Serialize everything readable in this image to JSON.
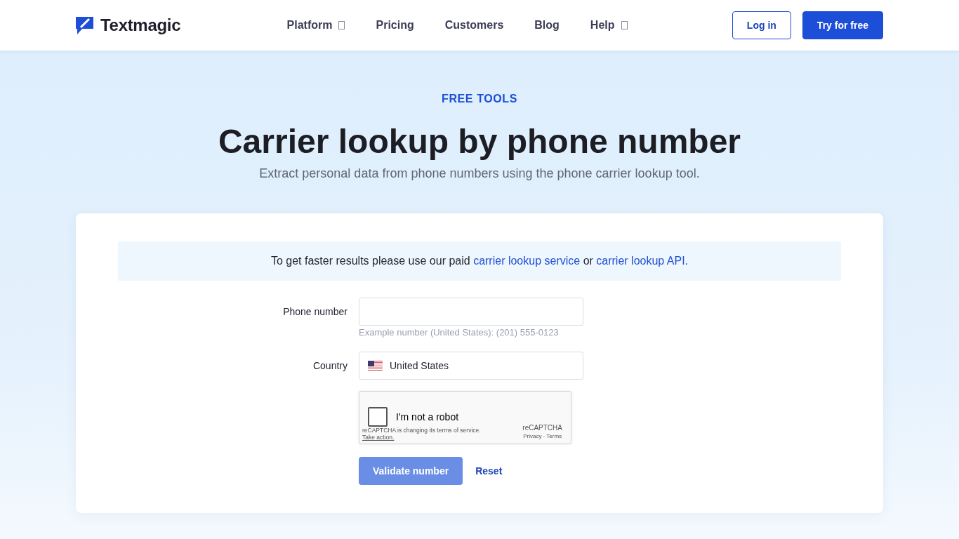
{
  "header": {
    "logo": {
      "text": "Textmagic"
    },
    "nav": [
      {
        "label": "Platform",
        "has_menu": true
      },
      {
        "label": "Pricing",
        "has_menu": false
      },
      {
        "label": "Customers",
        "has_menu": false
      },
      {
        "label": "Blog",
        "has_menu": false
      },
      {
        "label": "Help",
        "has_menu": true
      }
    ],
    "buttons": [
      {
        "label": "Log in",
        "kind": "outline"
      },
      {
        "label": "Try for free",
        "kind": "primary"
      }
    ]
  },
  "hero": {
    "eyebrow": "FREE TOOLS",
    "title": "Carrier lookup by phone number",
    "subtitle": "Extract personal data from phone numbers using the phone carrier lookup tool."
  },
  "card": {
    "notice": [
      {
        "kind": "text",
        "text": "To get faster results please use our paid "
      },
      {
        "kind": "link",
        "text": "carrier lookup service"
      },
      {
        "kind": "text",
        "text": " or "
      },
      {
        "kind": "link",
        "text": "carrier lookup API."
      }
    ],
    "fields": [
      {
        "kind": "input",
        "label": "Phone number",
        "hint": "Example number (United States): (201) 555-0123"
      },
      {
        "kind": "select",
        "label": "Country",
        "value": "United States"
      }
    ],
    "recaptcha": {
      "checked": false,
      "label": "I'm not a robot",
      "notice": "reCAPTCHA is changing its terms of service.",
      "action": "Take action.",
      "brand": "reCAPTCHA",
      "legal": "Privacy - Terms"
    },
    "actions": [
      {
        "kind": "primary",
        "label": "Validate number",
        "disabled": true
      },
      {
        "kind": "link",
        "label": "Reset"
      }
    ]
  }
}
